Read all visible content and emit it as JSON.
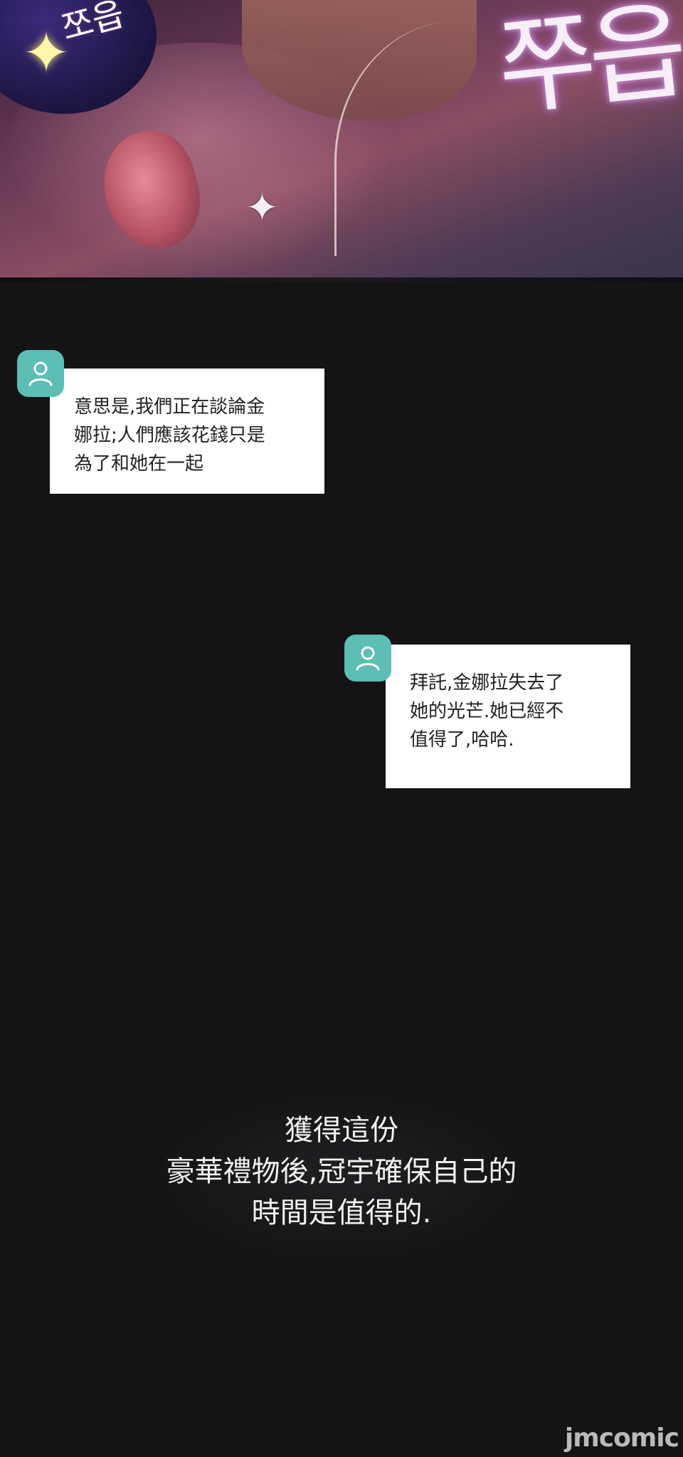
{
  "art": {
    "sfx_main": "쭈읍",
    "sfx_small": "쪼읍",
    "burst": "✦"
  },
  "messages": [
    {
      "text": "意思是,我們正在談論金\n娜拉;人們應該花錢只是\n為了和她在一起"
    },
    {
      "text": "拜託,金娜拉失去了\n她的光芒.她已經不\n值得了,哈哈."
    }
  ],
  "caption": "獲得這份\n豪華禮物後,冠宇確保自己的\n時間是值得的.",
  "watermark": "jmcomic",
  "colors": {
    "avatar": "#5cbeb4",
    "background": "#111113"
  }
}
